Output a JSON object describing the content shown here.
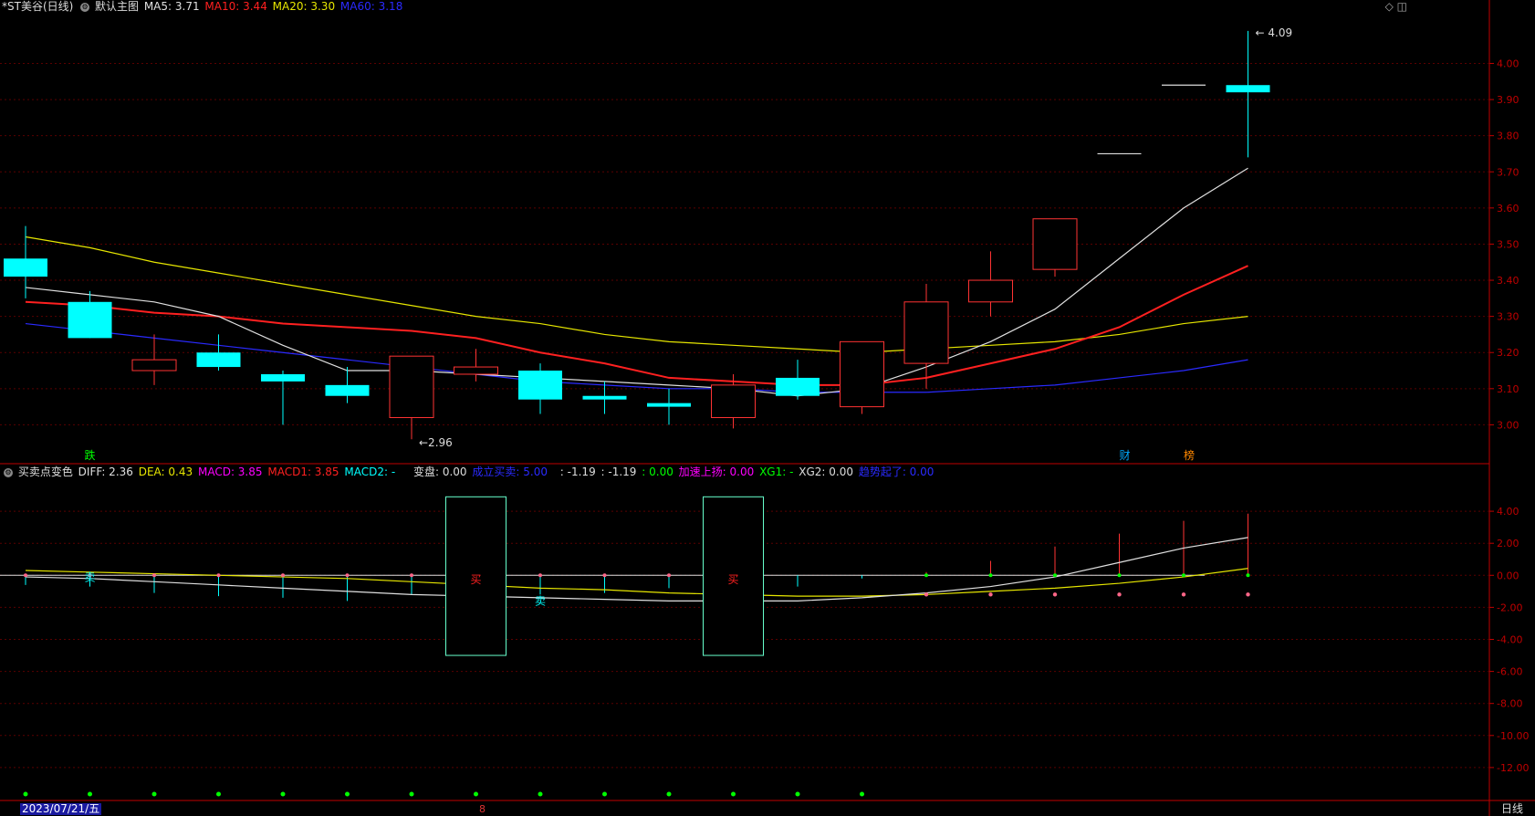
{
  "main_legend": {
    "title": "*ST美谷(日线)",
    "template": "默认主图",
    "ma5_label": "MA5: 3.71",
    "ma10_label": "MA10: 3.44",
    "ma20_label": "MA20: 3.30",
    "ma60_label": "MA60: 3.18"
  },
  "sub_legend": {
    "title": "买卖点变色",
    "diff": "DIFF: 2.36",
    "dea": "DEA: 0.43",
    "macd": "MACD: 3.85",
    "macd1": "MACD1: 3.85",
    "macd2": "MACD2: -",
    "biancheng": "变盘: 0.00",
    "chengli": "成立买卖: 5.00",
    "v1": ": -1.19",
    "v2": ": -1.19",
    "v3": ": 0.00",
    "jiasu": "加速上扬: 0.00",
    "xg1": "XG1: -",
    "xg2": "XG2: 0.00",
    "zhengzai": "趋势起了: 0.00"
  },
  "top_icons": "◇ ◫",
  "bottom": {
    "date": "2023/07/21/五",
    "period": "日线",
    "marker": "8"
  },
  "colors": {
    "up": "#ff3333",
    "down": "#00ffff",
    "ma5": "#e0e0e0",
    "ma10": "#ff2020",
    "ma20": "#e6e600",
    "ma60": "#2a2aff",
    "axis": "#c00000",
    "grid": "#5a0000"
  },
  "chart_data": [
    {
      "type": "candlestick",
      "title": "*ST美谷(日线)",
      "y_ticks": [
        "4.00",
        "3.90",
        "3.80",
        "3.70",
        "3.60",
        "3.50",
        "3.40",
        "3.30",
        "3.20",
        "3.10",
        "3.00"
      ],
      "ylim": [
        2.9,
        4.13
      ],
      "candles": [
        {
          "o": 3.46,
          "h": 3.55,
          "l": 3.35,
          "c": 3.41
        },
        {
          "o": 3.34,
          "h": 3.37,
          "l": 3.24,
          "c": 3.24
        },
        {
          "o": 3.15,
          "h": 3.25,
          "l": 3.11,
          "c": 3.18
        },
        {
          "o": 3.2,
          "h": 3.25,
          "l": 3.15,
          "c": 3.16
        },
        {
          "o": 3.14,
          "h": 3.15,
          "l": 3.0,
          "c": 3.12
        },
        {
          "o": 3.11,
          "h": 3.16,
          "l": 3.06,
          "c": 3.08
        },
        {
          "o": 3.02,
          "h": 3.19,
          "l": 2.96,
          "c": 3.19
        },
        {
          "o": 3.14,
          "h": 3.21,
          "l": 3.12,
          "c": 3.16
        },
        {
          "o": 3.15,
          "h": 3.17,
          "l": 3.03,
          "c": 3.07
        },
        {
          "o": 3.08,
          "h": 3.12,
          "l": 3.03,
          "c": 3.07
        },
        {
          "o": 3.06,
          "h": 3.1,
          "l": 3.0,
          "c": 3.05
        },
        {
          "o": 3.02,
          "h": 3.14,
          "l": 2.99,
          "c": 3.11
        },
        {
          "o": 3.13,
          "h": 3.18,
          "l": 3.07,
          "c": 3.08
        },
        {
          "o": 3.05,
          "h": 3.23,
          "l": 3.03,
          "c": 3.23
        },
        {
          "o": 3.17,
          "h": 3.39,
          "l": 3.1,
          "c": 3.34
        },
        {
          "o": 3.34,
          "h": 3.48,
          "l": 3.3,
          "c": 3.4
        },
        {
          "o": 3.43,
          "h": 3.57,
          "l": 3.41,
          "c": 3.57
        },
        {
          "o": 3.75,
          "h": 3.75,
          "l": 3.75,
          "c": 3.75
        },
        {
          "o": 3.94,
          "h": 3.94,
          "l": 3.94,
          "c": 3.94
        },
        {
          "o": 3.94,
          "h": 4.09,
          "l": 3.74,
          "c": 3.92
        }
      ],
      "ma5": [
        3.38,
        3.36,
        3.34,
        3.3,
        3.22,
        3.15,
        3.15,
        3.14,
        3.13,
        3.12,
        3.11,
        3.1,
        3.08,
        3.1,
        3.16,
        3.23,
        3.32,
        3.46,
        3.6,
        3.71
      ],
      "ma10": [
        3.34,
        3.33,
        3.31,
        3.3,
        3.28,
        3.27,
        3.26,
        3.24,
        3.2,
        3.17,
        3.13,
        3.12,
        3.11,
        3.11,
        3.13,
        3.17,
        3.21,
        3.27,
        3.36,
        3.44
      ],
      "ma20": [
        3.52,
        3.49,
        3.45,
        3.42,
        3.39,
        3.36,
        3.33,
        3.3,
        3.28,
        3.25,
        3.23,
        3.22,
        3.21,
        3.2,
        3.21,
        3.22,
        3.23,
        3.25,
        3.28,
        3.3
      ],
      "ma60": [
        3.28,
        3.26,
        3.24,
        3.22,
        3.2,
        3.18,
        3.16,
        3.14,
        3.12,
        3.11,
        3.1,
        3.1,
        3.09,
        3.09,
        3.09,
        3.1,
        3.11,
        3.13,
        3.15,
        3.18
      ],
      "annotations": [
        {
          "label": "4.09",
          "index": 19,
          "value": 4.09
        },
        {
          "label": "2.96",
          "index": 6,
          "value": 2.96
        }
      ],
      "event_tags": [
        {
          "label": "跌",
          "index": 1
        },
        {
          "label": "财",
          "index": 17
        },
        {
          "label": "榜",
          "index": 18
        }
      ]
    },
    {
      "type": "line",
      "title": "买卖点变色",
      "y_ticks": [
        "4.00",
        "2.00",
        "0.00",
        "-2.00",
        "-4.00",
        "-6.00",
        "-8.00",
        "-10.00",
        "-12.00"
      ],
      "ylim": [
        -14.0,
        6.0
      ],
      "diff": [
        -0.1,
        -0.2,
        -0.4,
        -0.6,
        -0.8,
        -1.0,
        -1.2,
        -1.3,
        -1.4,
        -1.5,
        -1.6,
        -1.6,
        -1.6,
        -1.4,
        -1.1,
        -0.7,
        -0.1,
        0.8,
        1.7,
        2.36
      ],
      "dea": [
        0.3,
        0.2,
        0.1,
        0.0,
        -0.1,
        -0.2,
        -0.4,
        -0.6,
        -0.8,
        -0.9,
        -1.1,
        -1.2,
        -1.3,
        -1.3,
        -1.2,
        -1.0,
        -0.8,
        -0.5,
        -0.1,
        0.43
      ],
      "macd_bars": [
        -0.6,
        -0.7,
        -1.1,
        -1.3,
        -1.4,
        -1.6,
        -1.2,
        -1.0,
        -1.2,
        -1.1,
        -0.8,
        -0.6,
        -0.7,
        -0.2,
        0.2,
        0.9,
        1.8,
        2.6,
        3.4,
        3.85
      ],
      "signal_boxes": [
        {
          "label": "买",
          "index_start": 7,
          "index_end": 7,
          "top": 4.9,
          "bottom": -5.0
        },
        {
          "label": "买",
          "index_start": 11,
          "index_end": 11,
          "top": 4.9,
          "bottom": -5.0
        }
      ],
      "mid_labels": [
        {
          "label": "卖",
          "index": 1,
          "value": 0.0
        },
        {
          "label": "卖",
          "index": 8,
          "value": -1.5
        }
      ]
    }
  ]
}
